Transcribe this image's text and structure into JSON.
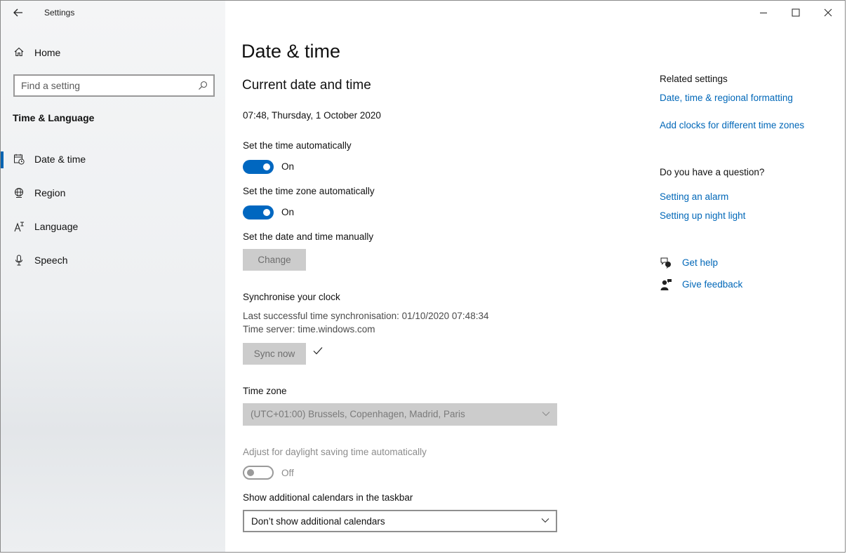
{
  "window": {
    "title": "Settings"
  },
  "sidebar": {
    "home_label": "Home",
    "search_placeholder": "Find a setting",
    "section_title": "Time & Language",
    "items": [
      {
        "label": "Date & time",
        "icon": "calendar-clock-icon",
        "active": true
      },
      {
        "label": "Region",
        "icon": "globe-icon",
        "active": false
      },
      {
        "label": "Language",
        "icon": "language-icon",
        "active": false
      },
      {
        "label": "Speech",
        "icon": "microphone-icon",
        "active": false
      }
    ]
  },
  "main": {
    "page_title": "Date & time",
    "section_title": "Current date and time",
    "current_datetime": "07:48, Thursday, 1 October 2020",
    "auto_time": {
      "label": "Set the time automatically",
      "state": "On"
    },
    "auto_timezone": {
      "label": "Set the time zone automatically",
      "state": "On"
    },
    "manual": {
      "label": "Set the date and time manually",
      "button": "Change"
    },
    "sync": {
      "title": "Synchronise your clock",
      "last_sync": "Last successful time synchronisation: 01/10/2020 07:48:34",
      "server": "Time server: time.windows.com",
      "button": "Sync now"
    },
    "timezone": {
      "label": "Time zone",
      "value": "(UTC+01:00) Brussels, Copenhagen, Madrid, Paris"
    },
    "dst": {
      "label": "Adjust for daylight saving time automatically",
      "state": "Off"
    },
    "calendars": {
      "label": "Show additional calendars in the taskbar",
      "value": "Don’t show additional calendars"
    }
  },
  "related": {
    "heading": "Related settings",
    "links": [
      "Date, time & regional formatting",
      "Add clocks for different time zones"
    ]
  },
  "question": {
    "heading": "Do you have a question?",
    "links": [
      "Setting an alarm",
      "Setting up night light"
    ]
  },
  "help": {
    "get_help": "Get help",
    "give_feedback": "Give feedback"
  },
  "colors": {
    "accent": "#0067c0",
    "link": "#0067b8",
    "disabled_bg": "#cccccc"
  }
}
